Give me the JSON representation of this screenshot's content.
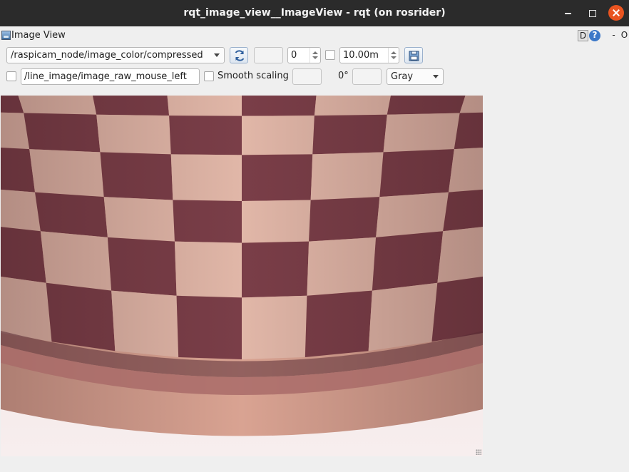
{
  "window": {
    "title": "rqt_image_view__ImageView - rqt (on rosrider)"
  },
  "plugin": {
    "title": "Image View",
    "header_buttons": {
      "d_label": "D",
      "help_label": "?",
      "dash_label": "-",
      "o_label": "O"
    }
  },
  "toolbar": {
    "topic": "/raspicam_node/image_color/compressed",
    "refresh_icon": "refresh-icon",
    "rotate_spinbox": "0",
    "max_value": "10.00m",
    "save_icon": "save-icon"
  },
  "toolbar2": {
    "mouse_topic": "/line_image/image_raw_mouse_left",
    "smooth_scaling_label": "Smooth scaling",
    "rotation_label": "0°",
    "color_scheme": "Gray"
  },
  "image": {
    "description_icon": "camera-image"
  },
  "colors": {
    "titlebar": "#2b2b2b",
    "close_button": "#e95420",
    "window_bg": "#efefef"
  }
}
